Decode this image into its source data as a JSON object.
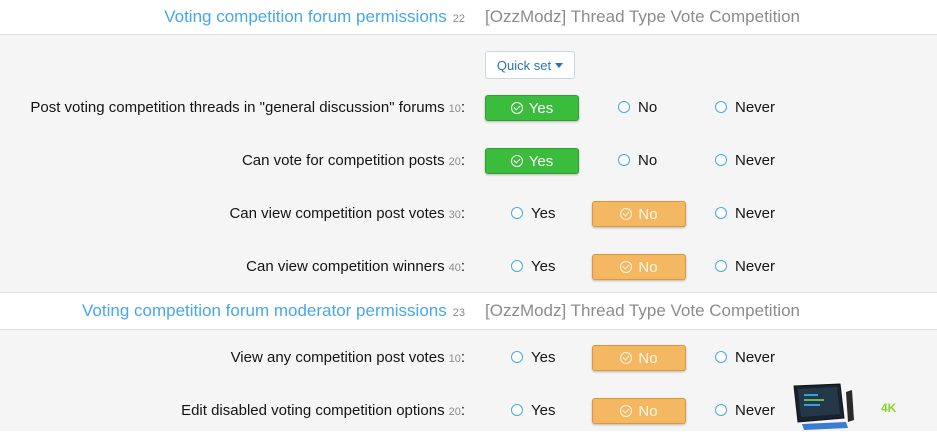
{
  "sections": [
    {
      "title": "Voting competition forum permissions",
      "order": "22",
      "source": "[OzzModz] Thread Type Vote Competition",
      "quick_set": "Quick set",
      "rows": [
        {
          "label": "Post voting competition threads in \"general discussion\" forums",
          "num": "10",
          "selected": "Yes"
        },
        {
          "label": "Can vote for competition posts",
          "num": "20",
          "selected": "Yes"
        },
        {
          "label": "Can view competition post votes",
          "num": "30",
          "selected": "No"
        },
        {
          "label": "Can view competition winners",
          "num": "40",
          "selected": "No"
        }
      ]
    },
    {
      "title": "Voting competition forum moderator permissions",
      "order": "23",
      "source": "[OzzModz] Thread Type Vote Competition",
      "rows": [
        {
          "label": "View any competition post votes",
          "num": "10",
          "selected": "No"
        },
        {
          "label": "Edit disabled voting competition options",
          "num": "20",
          "selected": "No"
        }
      ]
    }
  ],
  "options": {
    "yes": "Yes",
    "no": "No",
    "never": "Never"
  },
  "colon": ":",
  "watermark": {
    "text": "4K"
  },
  "colors": {
    "accent": "#47a7eb",
    "yes": "#3cbc3c",
    "no": "#f3b861"
  }
}
